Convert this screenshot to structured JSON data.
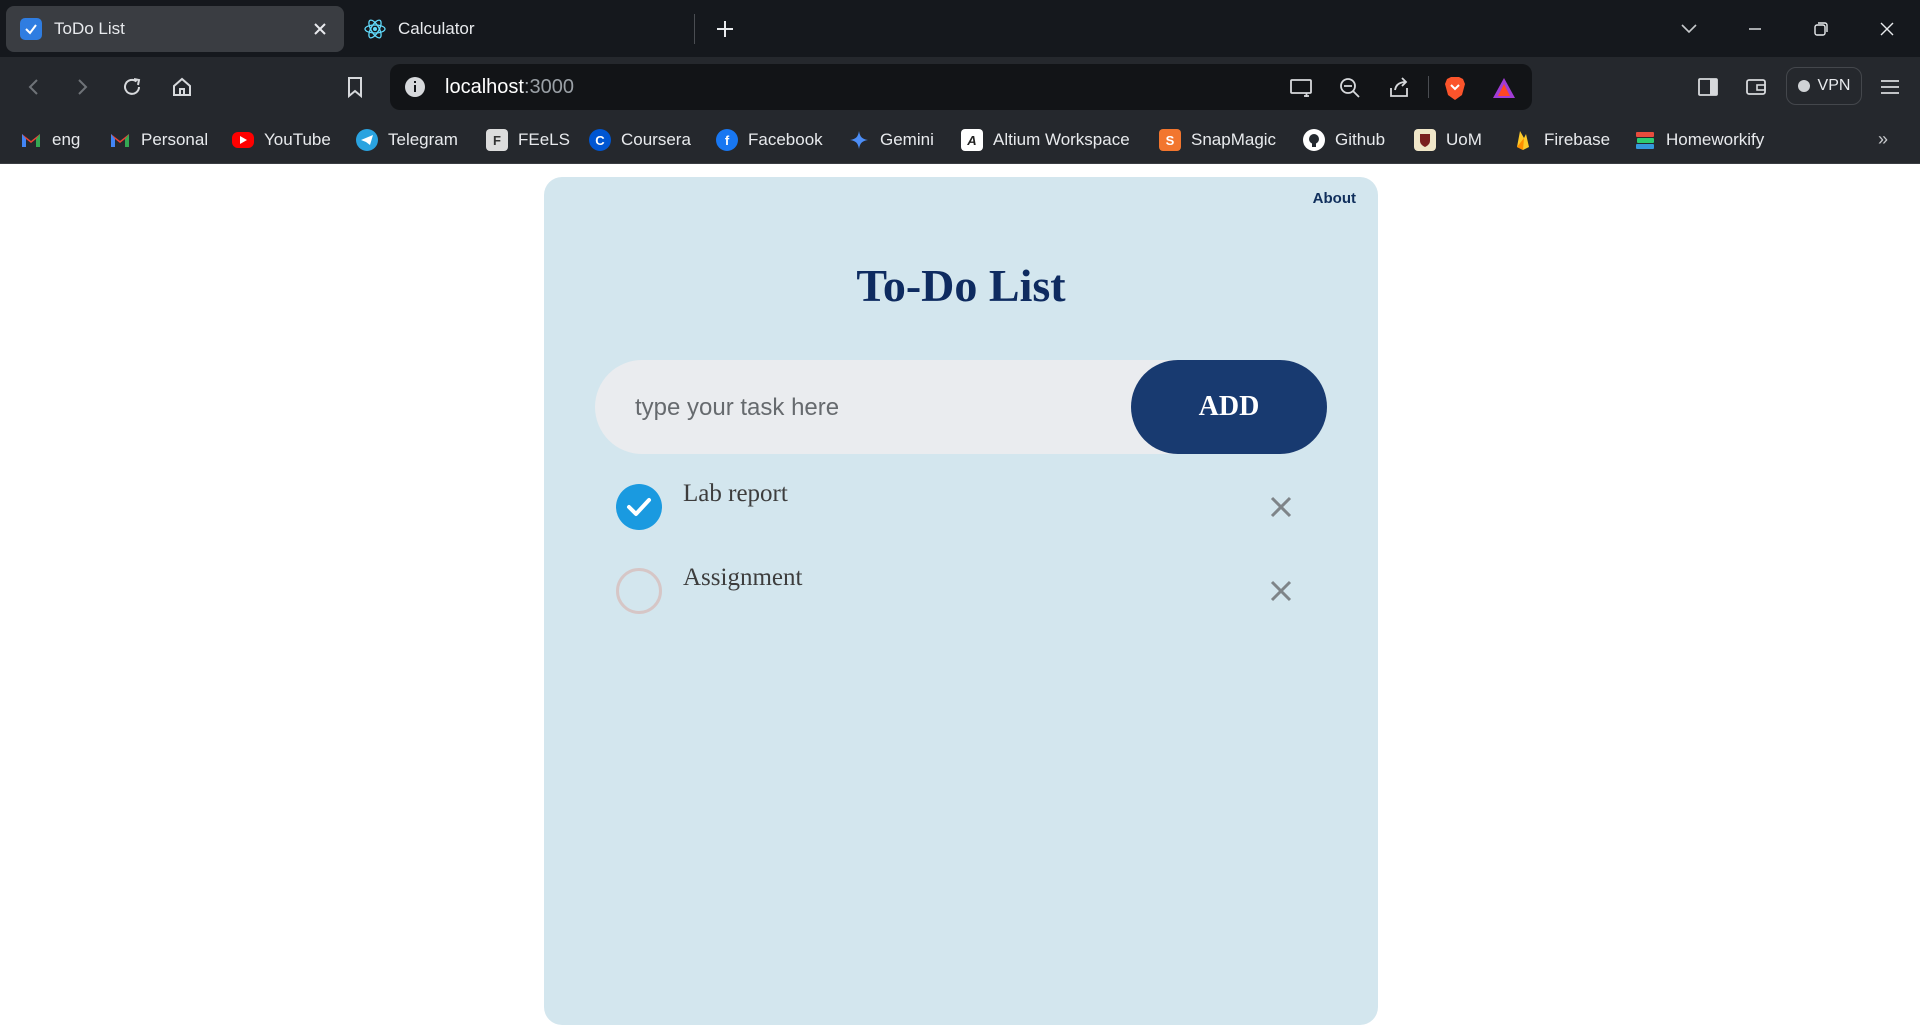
{
  "browser": {
    "tabs": [
      {
        "title": "ToDo List",
        "active": true
      },
      {
        "title": "Calculator",
        "active": false
      }
    ],
    "url": {
      "host": "localhost",
      "port": ":3000"
    },
    "vpn_label": "VPN",
    "bookmarks": [
      {
        "label": "eng",
        "icon": "gmail-icon"
      },
      {
        "label": "Personal",
        "icon": "gmail-icon"
      },
      {
        "label": "YouTube",
        "icon": "youtube-icon"
      },
      {
        "label": "Telegram",
        "icon": "telegram-icon"
      },
      {
        "label": "FEeLS",
        "icon": "feels-icon"
      },
      {
        "label": "Coursera",
        "icon": "coursera-icon"
      },
      {
        "label": "Facebook",
        "icon": "facebook-icon"
      },
      {
        "label": "Gemini",
        "icon": "gemini-icon"
      },
      {
        "label": "Altium Workspace",
        "icon": "altium-icon"
      },
      {
        "label": "SnapMagic",
        "icon": "snapmagic-icon"
      },
      {
        "label": "Github",
        "icon": "github-icon"
      },
      {
        "label": "UoM",
        "icon": "uom-icon"
      },
      {
        "label": "Firebase",
        "icon": "firebase-icon"
      },
      {
        "label": "Homeworkify",
        "icon": "homeworkify-icon"
      }
    ],
    "bookmarks_overflow": "»"
  },
  "app": {
    "nav_about": "About",
    "title": "To-Do List",
    "input_placeholder": "type your task here",
    "input_value": "",
    "add_label": "ADD",
    "tasks": [
      {
        "text": "Lab report",
        "completed": true
      },
      {
        "text": "Assignment",
        "completed": false
      }
    ]
  },
  "colors": {
    "card_bg": "#d3e6ee",
    "title": "#0e2b60",
    "add_button": "#183a70",
    "check_done": "#1a9ae0"
  }
}
